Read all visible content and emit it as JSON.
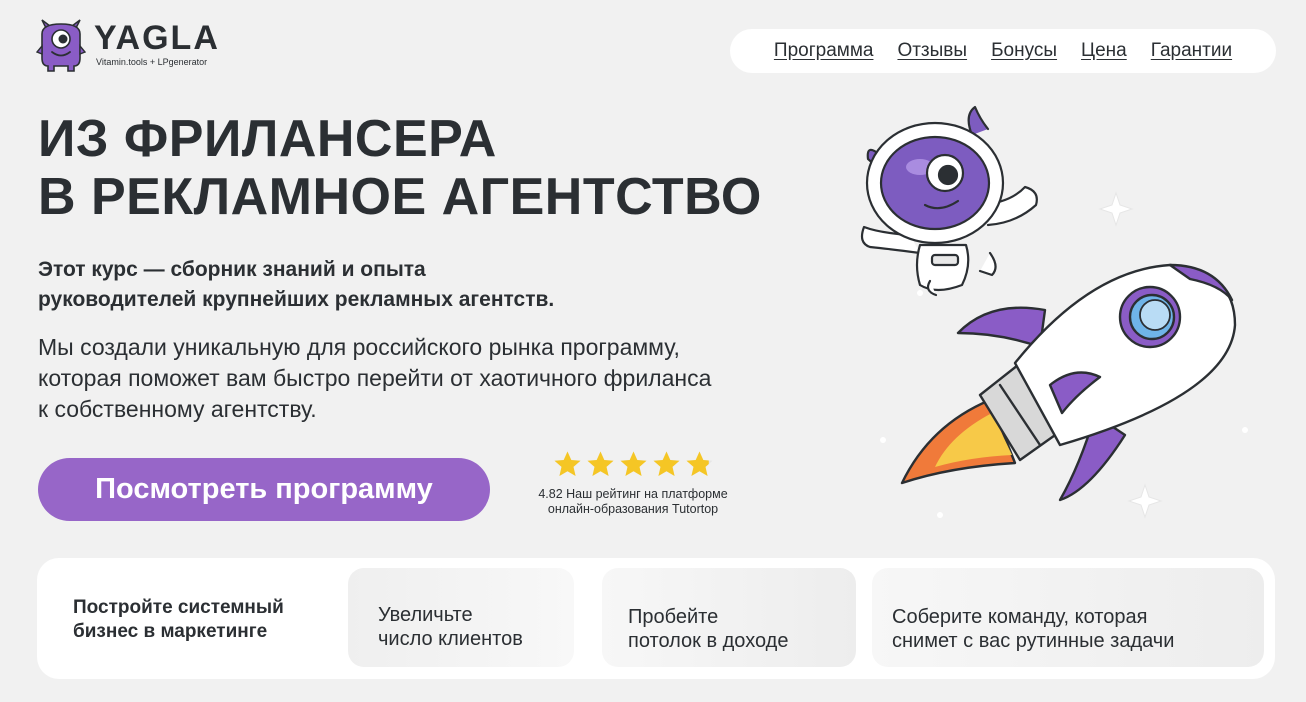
{
  "logo": {
    "word": "YAGLA",
    "sub": "Vitamin.tools + LPgenerator"
  },
  "nav": [
    "Программа",
    "Отзывы",
    "Бонусы",
    "Цена",
    "Гарантии"
  ],
  "hero": {
    "title_lines": [
      "ИЗ ФРИЛАНСЕРА",
      "В РЕКЛАМНОЕ АГЕНТСТВО"
    ],
    "subtitle_lines": [
      "Этот курс — сборник знаний и опыта",
      "руководителей крупнейших рекламных агентств."
    ],
    "desc_lines": [
      "Мы создали уникальную для российского рынка программу,",
      "которая поможет вам быстро перейти от хаотичного фриланса",
      "к собственному агентству."
    ],
    "cta_label": "Посмотреть программу"
  },
  "rating": {
    "value": 4.82,
    "stars_max": 5,
    "text_line1": "4.82 Наш рейтинг на платформе",
    "text_line2": "онлайн-образования Tutortop",
    "star_color": "#f5c625"
  },
  "panel": {
    "lead_lines": [
      "Постройте системный",
      "бизнес в маркетинге"
    ],
    "cards": [
      {
        "lines": [
          "Увеличьте",
          "число клиентов"
        ]
      },
      {
        "lines": [
          "Пробейте",
          "потолок в доходе"
        ]
      },
      {
        "lines": [
          "Соберите команду, которая",
          "снимет с вас рутинные задачи"
        ]
      }
    ]
  },
  "colors": {
    "accent": "#9766c8",
    "background": "#f1f1f1",
    "text": "#2b2f33"
  }
}
